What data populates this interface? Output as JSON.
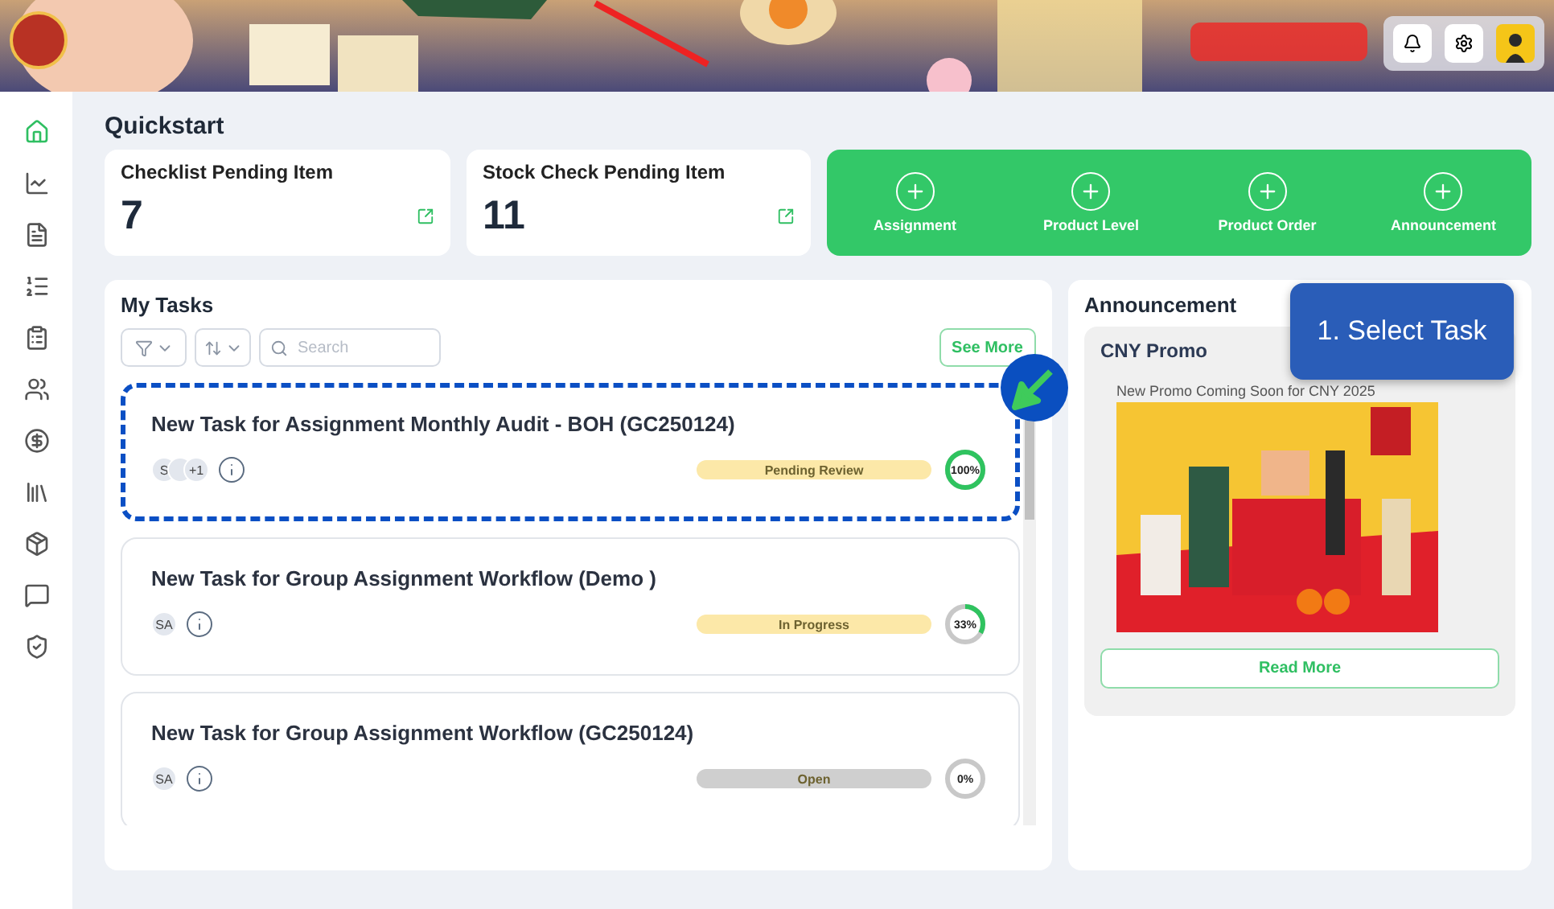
{
  "sidebar": {
    "items": [
      {
        "kind": "home",
        "selected": true
      },
      {
        "kind": "chart",
        "selected": false
      },
      {
        "kind": "document",
        "selected": false
      },
      {
        "kind": "checklist",
        "selected": false
      },
      {
        "kind": "clipboard",
        "selected": false
      },
      {
        "kind": "users",
        "selected": false
      },
      {
        "kind": "dollar",
        "selected": false
      },
      {
        "kind": "books",
        "selected": false
      },
      {
        "kind": "box",
        "selected": false
      },
      {
        "kind": "message",
        "selected": false
      },
      {
        "kind": "shield",
        "selected": false
      }
    ]
  },
  "quickstart": {
    "title": "Quickstart",
    "stats": [
      {
        "label": "Checklist Pending Item",
        "value": "7"
      },
      {
        "label": "Stock Check Pending Item",
        "value": "11"
      }
    ],
    "actions": [
      "Assignment",
      "Product Level",
      "Product Order",
      "Announcement"
    ]
  },
  "my_tasks": {
    "title": "My Tasks",
    "search": {
      "placeholder": "Search"
    },
    "see_more": "See More",
    "tasks": [
      {
        "title": "New Task for Assignment Monthly Audit - BOH (GC250124)",
        "selected": true,
        "avatars": [
          {
            "kind": "initials",
            "text": "S"
          },
          {
            "kind": "blank"
          },
          {
            "kind": "count",
            "text": "+1"
          }
        ],
        "status": "Pending Review",
        "color": "#fce8a8",
        "progress": "100%",
        "level": 1
      },
      {
        "title": "New Task for Group Assignment Workflow (Demo )",
        "selected": false,
        "avatars": [
          {
            "kind": "initials",
            "text": "SA"
          }
        ],
        "status": "In Progress",
        "color": "#fce8a8",
        "progress": "33%",
        "level": 0.33
      },
      {
        "title": "New Task for Group Assignment Workflow (GC250124)",
        "selected": false,
        "avatars": [
          {
            "kind": "initials",
            "text": "SA"
          }
        ],
        "status": "Open",
        "color": "#cfcfcf",
        "progress": "0%",
        "level": 0
      }
    ]
  },
  "announcement": {
    "title": "Announcement",
    "card": {
      "title": "CNY Promo",
      "subtitle": "New Promo Coming Soon for CNY 2025",
      "button": "Read More"
    }
  },
  "guide_tooltip": {
    "text": "1. Select Task"
  }
}
